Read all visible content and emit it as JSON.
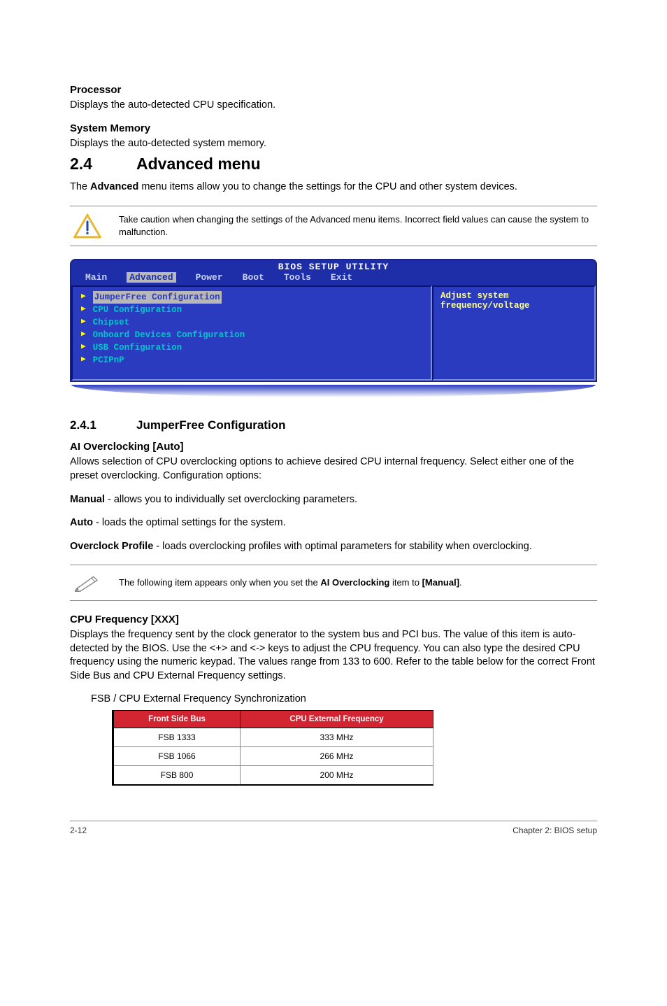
{
  "sections": {
    "processor": {
      "heading": "Processor",
      "text": "Displays the auto-detected CPU specification."
    },
    "sysmem": {
      "heading": "System Memory",
      "text": "Displays the auto-detected system memory."
    }
  },
  "advanced": {
    "num": "2.4",
    "title": "Advanced menu",
    "intro_1": "The ",
    "intro_bold": "Advanced",
    "intro_2": " menu items allow you to change the settings for the CPU and other system devices."
  },
  "caution_note": "Take caution when changing the settings of the Advanced menu items. Incorrect field values can cause the system to malfunction.",
  "bios": {
    "title": "BIOS SETUP UTILITY",
    "tabs": [
      "Main",
      "Advanced",
      "Power",
      "Boot",
      "Tools",
      "Exit"
    ],
    "active_tab": "Advanced",
    "items": [
      "JumperFree Configuration",
      "CPU Configuration",
      "Chipset",
      "Onboard Devices Configuration",
      "USB Configuration",
      "PCIPnP"
    ],
    "selected_item": "JumperFree Configuration",
    "help": [
      "Adjust system",
      "frequency/voltage"
    ]
  },
  "jumperfree": {
    "num": "2.4.1",
    "title": "JumperFree Configuration"
  },
  "ai_oc": {
    "heading": "AI Overclocking [Auto]",
    "desc": "Allows selection of CPU overclocking options to achieve desired CPU internal frequency. Select either one of the preset overclocking. Configuration options:",
    "manual_lead": "Manual",
    "manual_text": " - allows you to individually set overclocking parameters.",
    "auto_lead": "Auto",
    "auto_text": " - loads the optimal settings for the system.",
    "ocprofile_lead": "Overclock Profile",
    "ocprofile_text": " - loads overclocking profiles with optimal parameters for stability when overclocking."
  },
  "note": {
    "p1": "The following item appears only when you set the ",
    "b1": "AI Overclocking",
    "p2": " item to ",
    "b2": "[Manual]",
    "p3": "."
  },
  "cpufreq": {
    "heading": "CPU Frequency [XXX]",
    "desc": "Displays the frequency sent by the clock generator to the system bus and PCI bus. The value of this item is auto-detected by the BIOS. Use the <+> and <-> keys to adjust the CPU frequency. You can also type the desired CPU frequency using the numeric keypad. The values range from 133 to 600. Refer to the table below for the correct Front Side Bus and CPU External Frequency settings."
  },
  "fsb_table": {
    "caption": "FSB / CPU External Frequency Synchronization",
    "headers": [
      "Front Side Bus",
      "CPU External Frequency"
    ],
    "rows": [
      [
        "FSB 1333",
        "333 MHz"
      ],
      [
        "FSB 1066",
        "266 MHz"
      ],
      [
        "FSB 800",
        "200 MHz"
      ]
    ]
  },
  "footer": {
    "left": "2-12",
    "right": "Chapter 2: BIOS setup"
  }
}
